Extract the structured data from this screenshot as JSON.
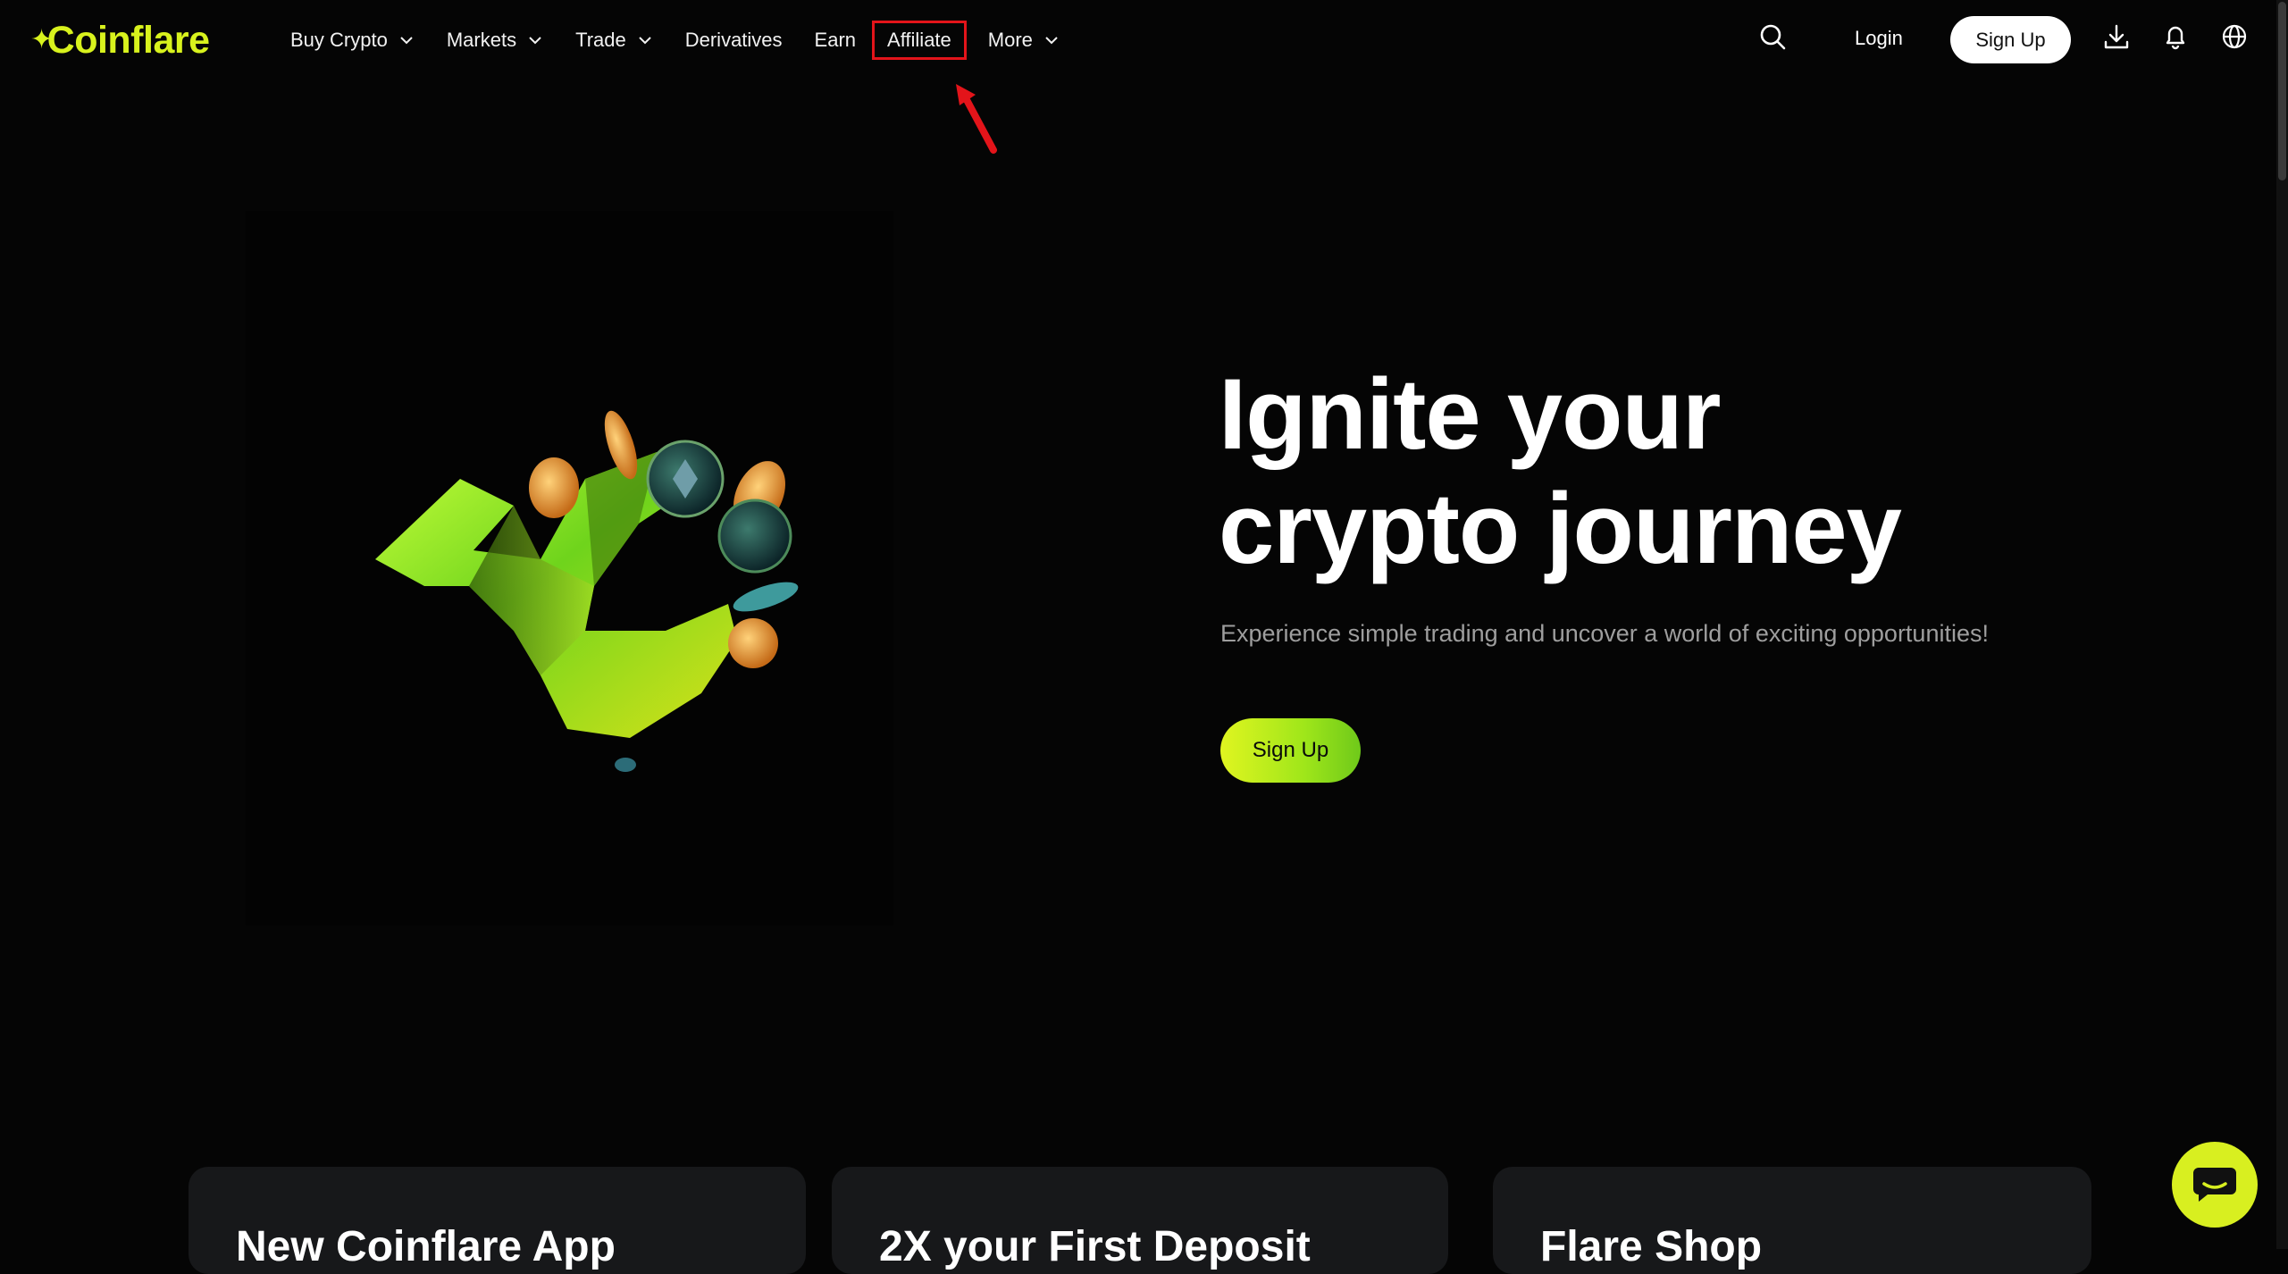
{
  "brand": {
    "logo_text": "Coinflare",
    "accent_color": "#d8f21d"
  },
  "nav": {
    "items": [
      {
        "label": "Buy Crypto",
        "has_dropdown": true
      },
      {
        "label": "Markets",
        "has_dropdown": true
      },
      {
        "label": "Trade",
        "has_dropdown": true
      },
      {
        "label": "Derivatives",
        "has_dropdown": false
      },
      {
        "label": "Earn",
        "has_dropdown": false
      },
      {
        "label": "Affiliate",
        "has_dropdown": false,
        "highlighted": true
      },
      {
        "label": "More",
        "has_dropdown": true
      }
    ]
  },
  "header_actions": {
    "search_icon": "search-icon",
    "login_label": "Login",
    "signup_label": "Sign Up",
    "download_icon": "download-icon",
    "bell_icon": "bell-icon",
    "globe_icon": "globe-icon"
  },
  "hero": {
    "title_line1": "Ignite your",
    "title_line2": "crypto journey",
    "subtitle": "Experience simple trading and uncover a world of exciting opportunities!",
    "cta_label": "Sign Up"
  },
  "cards": [
    {
      "title": "New Coinflare App"
    },
    {
      "title": "2X your First Deposit"
    },
    {
      "title": "Flare Shop"
    }
  ],
  "annotation": {
    "color": "#e3141a"
  }
}
